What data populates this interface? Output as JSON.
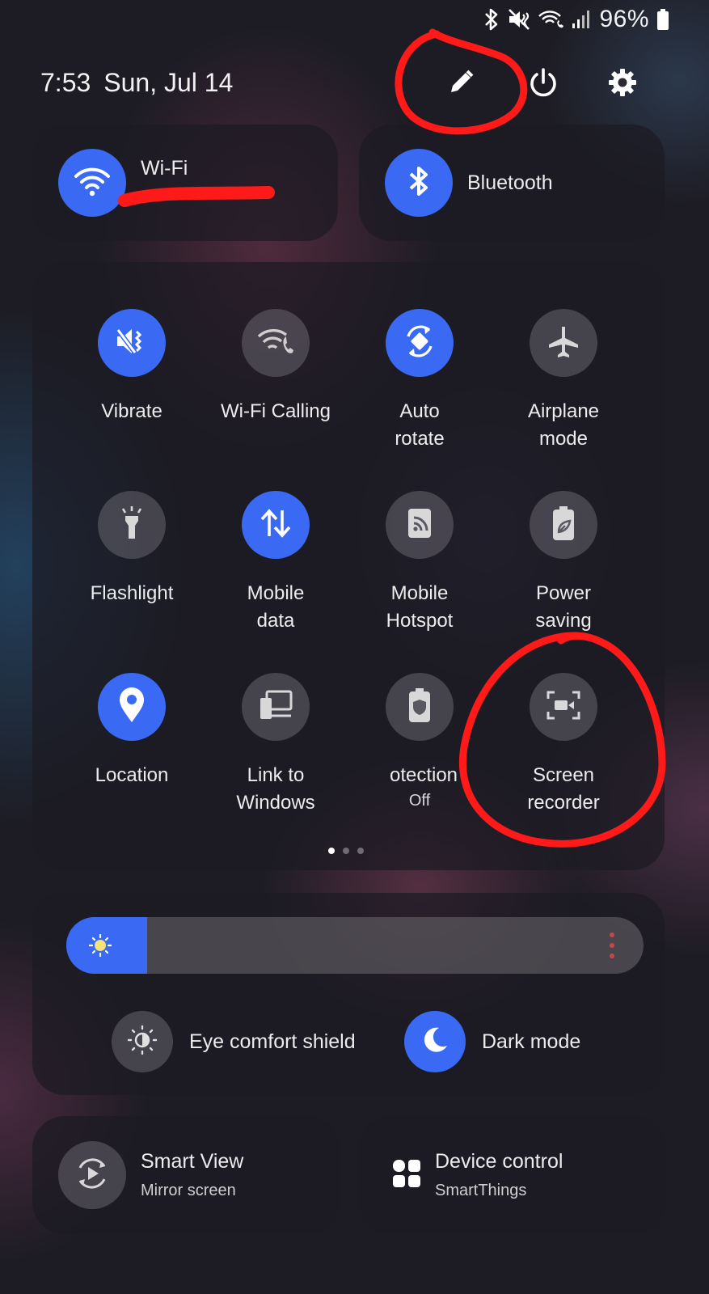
{
  "status_bar": {
    "battery_percent": "96%",
    "icons": [
      "bluetooth-icon",
      "mute-vibrate-icon",
      "wifi-calling-icon",
      "signal-icon",
      "battery-icon"
    ]
  },
  "header": {
    "time": "7:53",
    "date": "Sun, Jul 14",
    "buttons": [
      "edit-icon",
      "power-icon",
      "settings-icon"
    ]
  },
  "top_tiles": {
    "wifi": {
      "label": "Wi-Fi",
      "state": "on"
    },
    "bluetooth": {
      "label": "Bluetooth",
      "state": "on"
    }
  },
  "quick_settings": [
    {
      "label": "Vibrate",
      "icon": "vibrate-icon",
      "state": "on"
    },
    {
      "label": "Wi-Fi Calling",
      "icon": "wifi-calling-icon",
      "state": "off"
    },
    {
      "label": "Auto\nrotate",
      "icon": "auto-rotate-icon",
      "state": "on"
    },
    {
      "label": "Airplane\nmode",
      "icon": "airplane-icon",
      "state": "off"
    },
    {
      "label": "Flashlight",
      "icon": "flashlight-icon",
      "state": "off"
    },
    {
      "label": "Mobile\ndata",
      "icon": "mobile-data-icon",
      "state": "on"
    },
    {
      "label": "Mobile\nHotspot",
      "icon": "hotspot-icon",
      "state": "off"
    },
    {
      "label": "Power\nsaving",
      "icon": "power-saving-icon",
      "state": "off"
    },
    {
      "label": "Location",
      "icon": "location-icon",
      "state": "on"
    },
    {
      "label": "Link to\nWindows",
      "icon": "link-to-windows-icon",
      "state": "off"
    },
    {
      "label": "otection",
      "sub": "Off",
      "icon": "battery-protection-icon",
      "state": "off"
    },
    {
      "label": "Screen\nrecorder",
      "icon": "screen-recorder-icon",
      "state": "off"
    }
  ],
  "pager": {
    "pages": 3,
    "current": 1
  },
  "brightness": {
    "level": 0.14
  },
  "toggles": {
    "eye_comfort": {
      "label": "Eye comfort shield",
      "state": "off"
    },
    "dark_mode": {
      "label": "Dark mode",
      "state": "on"
    }
  },
  "bottom_tiles": {
    "smart_view": {
      "title": "Smart View",
      "subtitle": "Mirror screen"
    },
    "device_control": {
      "title": "Device control",
      "subtitle": "SmartThings"
    }
  },
  "colors": {
    "accent": "#3a6af4",
    "annotation": "#ff1a1a"
  }
}
